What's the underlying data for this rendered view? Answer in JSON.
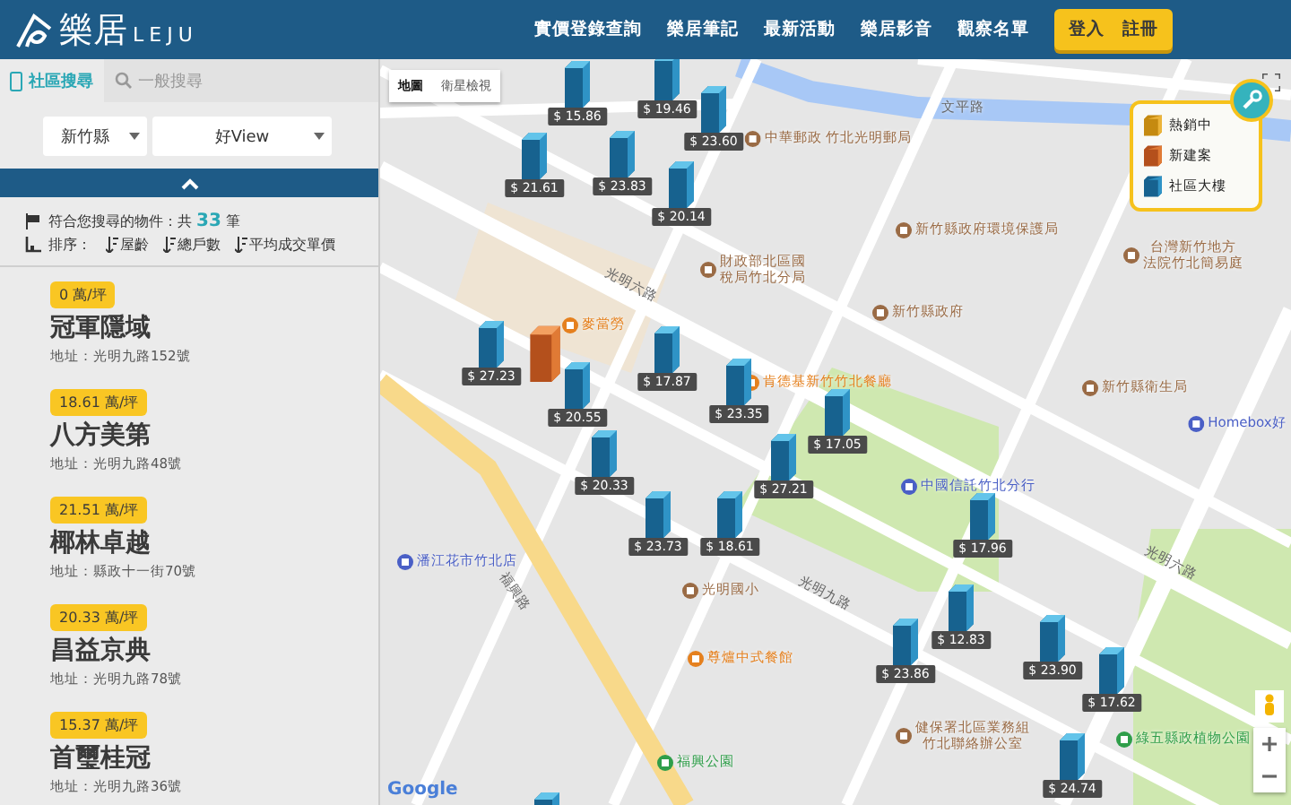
{
  "header": {
    "logo_text": "樂居",
    "logo_subtext": "LEJU",
    "nav": [
      "實價登錄查詢",
      "樂居筆記",
      "最新活動",
      "樂居影音",
      "觀察名單"
    ],
    "auth_links": [
      "登入",
      "註冊"
    ]
  },
  "sidebar": {
    "tabs": [
      {
        "label": "社區搜尋",
        "selected": true
      },
      {
        "label": "一般搜尋",
        "selected": false
      }
    ],
    "filters": [
      {
        "value": "新竹縣"
      },
      {
        "value": "好View"
      }
    ],
    "result_text": "符合您搜尋的物件：共",
    "result_count": "33",
    "result_unit": "筆",
    "sort_label": "排序：",
    "sort_options": [
      "屋齡",
      "總戶數",
      "平均成交單價"
    ],
    "listings": [
      {
        "price": "0 萬/坪",
        "name": "冠軍隱域",
        "address": "地址：光明九路152號"
      },
      {
        "price": "18.61 萬/坪",
        "name": "八方美第",
        "address": "地址：光明九路48號"
      },
      {
        "price": "21.51 萬/坪",
        "name": "椰林卓越",
        "address": "地址：縣政十一街70號"
      },
      {
        "price": "20.33 萬/坪",
        "name": "昌益京典",
        "address": "地址：光明九路78號"
      },
      {
        "price": "15.37 萬/坪",
        "name": "首璽桂冠",
        "address": "地址：光明九路36號"
      }
    ]
  },
  "map": {
    "map_types": [
      {
        "label": "地圖",
        "selected": true
      },
      {
        "label": "衛星檢視",
        "selected": false
      }
    ],
    "legend": [
      {
        "kind": "hot",
        "label": "熱銷中"
      },
      {
        "kind": "new-build",
        "label": "新建案"
      },
      {
        "kind": "community",
        "label": "社區大樓"
      }
    ],
    "places": [
      {
        "kind": "post",
        "lines": [
          "中華郵政 竹北光明郵局"
        ]
      },
      {
        "kind": "road",
        "lines": [
          "文平路"
        ]
      },
      {
        "kind": "government",
        "lines": [
          "新竹縣政府環境保護局"
        ]
      },
      {
        "kind": "government",
        "lines": [
          "財政部北區國",
          "稅局竹北分局"
        ]
      },
      {
        "kind": "government",
        "lines": [
          "新竹縣政府"
        ]
      },
      {
        "kind": "government",
        "lines": [
          "台灣新竹地方",
          "法院竹北簡易庭"
        ]
      },
      {
        "kind": "food",
        "lines": [
          "麥當勞"
        ]
      },
      {
        "kind": "food",
        "lines": [
          "肯德基新竹竹北餐廳"
        ]
      },
      {
        "kind": "government",
        "lines": [
          "新竹縣衛生局"
        ]
      },
      {
        "kind": "shop",
        "lines": [
          "Homebox好"
        ]
      },
      {
        "kind": "bank",
        "lines": [
          "中國信託竹北分行"
        ]
      },
      {
        "kind": "shop",
        "lines": [
          "潘江花市竹北店"
        ]
      },
      {
        "kind": "school",
        "lines": [
          "光明國小"
        ]
      },
      {
        "kind": "food",
        "lines": [
          "尊爐中式餐館"
        ]
      },
      {
        "kind": "government",
        "lines": [
          "健保署北區業務組",
          "竹北聯絡辦公室"
        ]
      },
      {
        "kind": "park",
        "lines": [
          "綠五縣政植物公園"
        ]
      },
      {
        "kind": "park",
        "lines": [
          "福興公園"
        ]
      }
    ],
    "roads": [
      "光明六路",
      "光明六路",
      "光明九路",
      "福興路"
    ],
    "markers": [
      {
        "kind": "community",
        "price": "$ 19.46"
      },
      {
        "kind": "community",
        "price": "$ 15.86"
      },
      {
        "kind": "community",
        "price": "$ 23.60"
      },
      {
        "kind": "community",
        "price": "$ 21.61"
      },
      {
        "kind": "community",
        "price": "$ 23.83"
      },
      {
        "kind": "community",
        "price": "$ 20.14"
      },
      {
        "kind": "community",
        "price": "$ 27.23"
      },
      {
        "kind": "new-build"
      },
      {
        "kind": "community",
        "price": "$ 17.87"
      },
      {
        "kind": "community",
        "price": "$ 23.35"
      },
      {
        "kind": "community",
        "price": "$ 20.55"
      },
      {
        "kind": "community",
        "price": "$ 17.05"
      },
      {
        "kind": "community",
        "price": "$ 20.33"
      },
      {
        "kind": "community",
        "price": "$ 27.21"
      },
      {
        "kind": "community",
        "price": "$ 23.73"
      },
      {
        "kind": "community",
        "price": "$ 18.61"
      },
      {
        "kind": "community",
        "price": "$ 17.96"
      },
      {
        "kind": "community",
        "price": "$ 12.83"
      },
      {
        "kind": "community",
        "price": "$ 23.86"
      },
      {
        "kind": "community",
        "price": "$ 23.90"
      },
      {
        "kind": "community",
        "price": "$ 17.62"
      },
      {
        "kind": "community",
        "price": "$ 24.74"
      },
      {
        "kind": "community"
      }
    ],
    "attribution": "Google"
  }
}
